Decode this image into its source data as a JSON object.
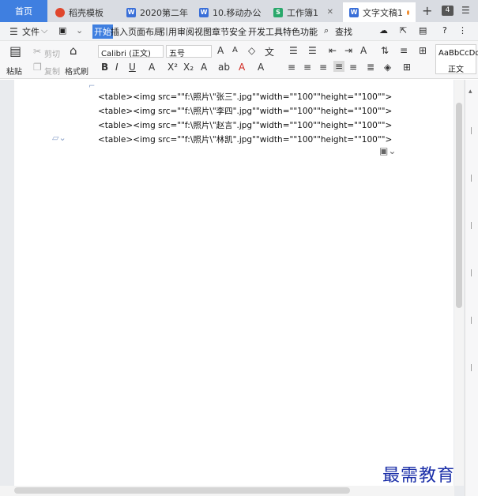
{
  "tabs": [
    {
      "label": "首页",
      "icon": "none"
    },
    {
      "label": "稻壳模板",
      "icon": "daoke-icon"
    },
    {
      "label": "2020第二年",
      "icon": "w-doc-icon"
    },
    {
      "label": "10.移动办公",
      "icon": "w-doc-icon"
    },
    {
      "label": "工作簿1",
      "icon": "s-sheet-icon"
    },
    {
      "label": "文字文稿1",
      "icon": "w-doc-icon"
    }
  ],
  "tab_count": "4",
  "menu": {
    "file": "文件",
    "items": [
      "开始",
      "插入",
      "页面布局",
      "引用",
      "审阅",
      "视图",
      "章节",
      "安全",
      "开发工具",
      "特色功能"
    ],
    "search": "查找"
  },
  "ribbon": {
    "paste": "粘贴",
    "cut": "剪切",
    "copy": "复制",
    "format_painter": "格式刷",
    "font_name": "Calibri (正文)",
    "font_size": "五号",
    "style_preview": "AaBbCcDd",
    "style_name": "正文"
  },
  "document": {
    "lines": [
      "<table><img src=\"\"f:\\照片\\\"张三\".jpg\"\"width=\"\"100\"\"height=\"\"100\"\">",
      "<table><img src=\"\"f:\\照片\\\"李四\".jpg\"\"width=\"\"100\"\"height=\"\"100\"\">",
      "<table><img src=\"\"f:\\照片\\\"赵言\".jpg\"\"width=\"\"100\"\"height=\"\"100\"\">",
      "<table><img src=\"\"f:\\照片\\\"林凯\".jpg\"\"width=\"\"100\"\"height=\"\"100\"\">"
    ]
  },
  "watermark": "最需教育",
  "colors": {
    "accent": "#3f7fe0",
    "watermark": "#1b2fa8"
  }
}
